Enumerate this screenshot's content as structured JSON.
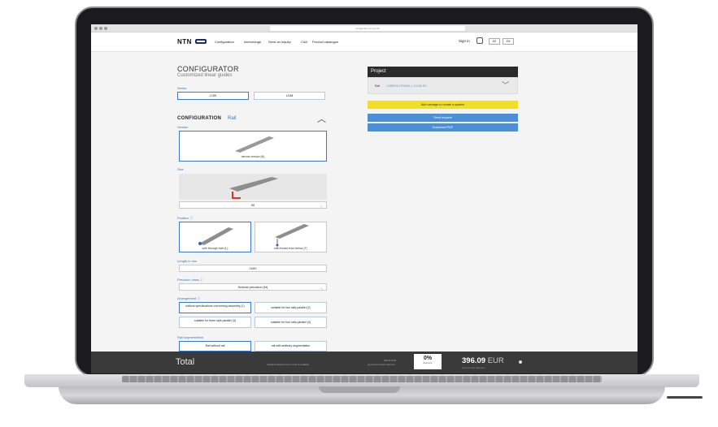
{
  "browser": {
    "url": "configurator.ntn-snr.de"
  },
  "header": {
    "logo_text": "NTN",
    "nav": [
      "Configuration",
      "Interchange",
      "Send an inquiry",
      "CAD",
      "Product catalogue"
    ],
    "signin": "Sign in",
    "languages": [
      "DE",
      "EN"
    ]
  },
  "configurator": {
    "title": "CONFIGURATOR",
    "subtitle": "Customized linear guides",
    "series_label": "Series",
    "series_options": [
      "LGB",
      "LGM"
    ],
    "config_heading": "CONFIGURATION",
    "config_part": "Rail",
    "version_label": "Version",
    "version_caption": "narrow version (N)",
    "size_label": "Size",
    "size_value": "30",
    "fixation_label": "Fixation ⓘ",
    "fixation_options": [
      "with through hole (L)",
      "with thread from below (T)"
    ],
    "length_label": "Length in mm",
    "length_value": "1000",
    "precision_label": "Precision class ⓘ",
    "precision_value": "Normal precision (N)",
    "arrangement_label": "Arrangement ⓘ",
    "arrangement_options": [
      "without specifications concerning assembly (1)",
      "suitable for two rails parallel (2)",
      "suitable for three rails parallel (3)",
      "suitable for four rails parallel (4)"
    ],
    "segmentation_label": "Rail segmentation",
    "segmentation_options": [
      "Rail without rail",
      "rail with arbitrary segmentation"
    ]
  },
  "project": {
    "header": "Project",
    "rail_label": "Rail",
    "rail_code": "LGBR30L2TN0001-1-S1-B2-R0",
    "add_carriage": "Add carriage to create a system",
    "send_request": "Send request",
    "download_pdf": "Download PDF"
  },
  "footer": {
    "total_label": "Total",
    "delivery_note": "Indicated delivery time if stock is available",
    "price_note_small": "396,09 EUR",
    "price_note_sub": "gross price before discount",
    "discount_value": "0%",
    "discount_label": "Discount",
    "price_value": "396.09",
    "price_currency": "EUR",
    "price_note": "net price after discount"
  },
  "colors": {
    "accent": "#3b78c8",
    "project_header": "#2a2a2a",
    "add_carriage": "#f2dc2c",
    "action_blue": "#4a90d9",
    "footer": "#3a3a3a"
  }
}
